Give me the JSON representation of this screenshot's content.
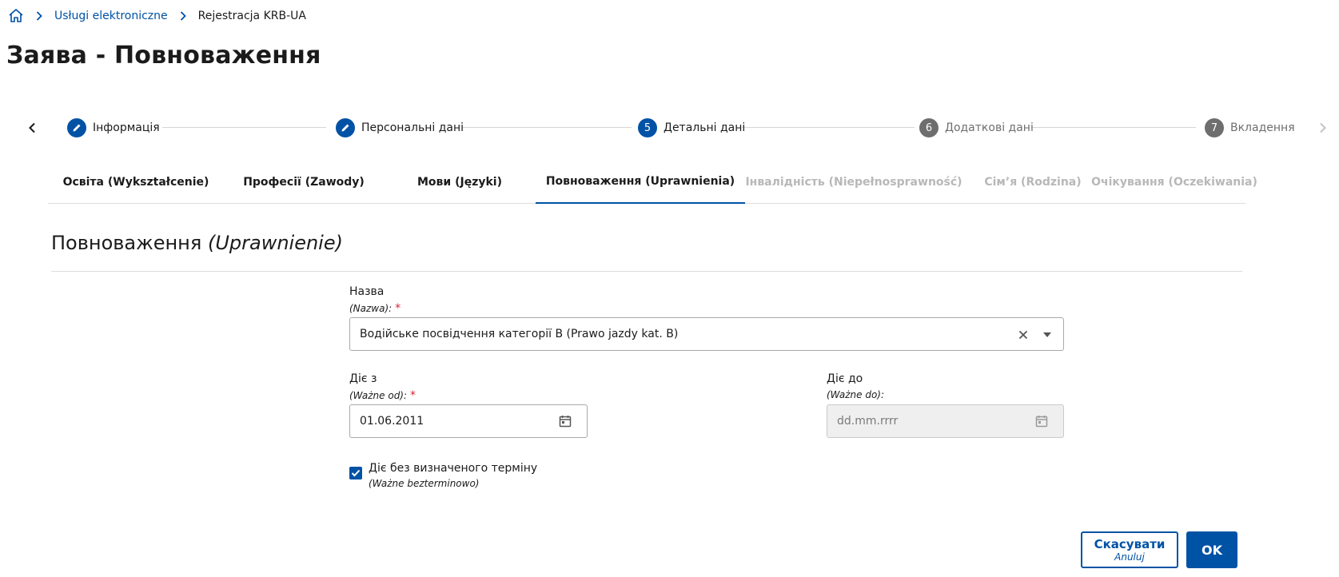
{
  "breadcrumb": {
    "home_icon": "home-icon",
    "items": [
      "Usługi elektroniczne",
      "Rejestracja KRB-UA"
    ]
  },
  "page_title": "Заява - Повноваження",
  "stepper": {
    "steps": [
      {
        "badge": "",
        "icon": "pencil-icon",
        "label": "Інформація",
        "state": "completed"
      },
      {
        "badge": "",
        "icon": "pencil-icon",
        "label": "Персональні дані",
        "state": "completed"
      },
      {
        "badge": "5",
        "label": "Детальні дані",
        "state": "current"
      },
      {
        "badge": "6",
        "label": "Додаткові дані",
        "state": "upcoming"
      },
      {
        "badge": "7",
        "label": "Вкладення",
        "state": "upcoming"
      }
    ]
  },
  "tabs": [
    {
      "label": "Освіта (Wykształcenie)",
      "state": "normal"
    },
    {
      "label": "Професії (Zawody)",
      "state": "normal"
    },
    {
      "label": "Мови (Języki)",
      "state": "normal"
    },
    {
      "label": "Повноваження (Uprawnienia)",
      "state": "active"
    },
    {
      "label": "Інвалідність (Niepełnosprawność)",
      "state": "disabled"
    },
    {
      "label": "Сім’я (Rodzina)",
      "state": "disabled"
    },
    {
      "label": "Очікування (Oczekiwania)",
      "state": "disabled"
    }
  ],
  "section": {
    "title": "Повноваження",
    "title_pl": "(Uprawnienie)"
  },
  "form": {
    "name": {
      "label": "Назва",
      "sublabel": "(Nazwa):",
      "required_mark": "*",
      "value": "Водійське посвідчення категорії B (Prawo jazdy kat. B)"
    },
    "valid_from": {
      "label": "Діє з",
      "sublabel": "(Ważne od):",
      "required_mark": "*",
      "value": "01.06.2011"
    },
    "valid_to": {
      "label": "Діє до",
      "sublabel": "(Ważne do):",
      "placeholder": "dd.mm.rrrr"
    },
    "indefinite": {
      "label": "Діє без визначеного терміну",
      "sublabel": "(Ważne bezterminowo)",
      "checked": true
    }
  },
  "buttons": {
    "cancel_label": "Скасувати",
    "cancel_sub": "Anuluj",
    "ok_label": "OK"
  },
  "colors": {
    "accent": "#0052a5",
    "required": "#d4263a",
    "inactive_badge": "#6e6e6e",
    "disabled_tab": "#b8b8b8"
  }
}
